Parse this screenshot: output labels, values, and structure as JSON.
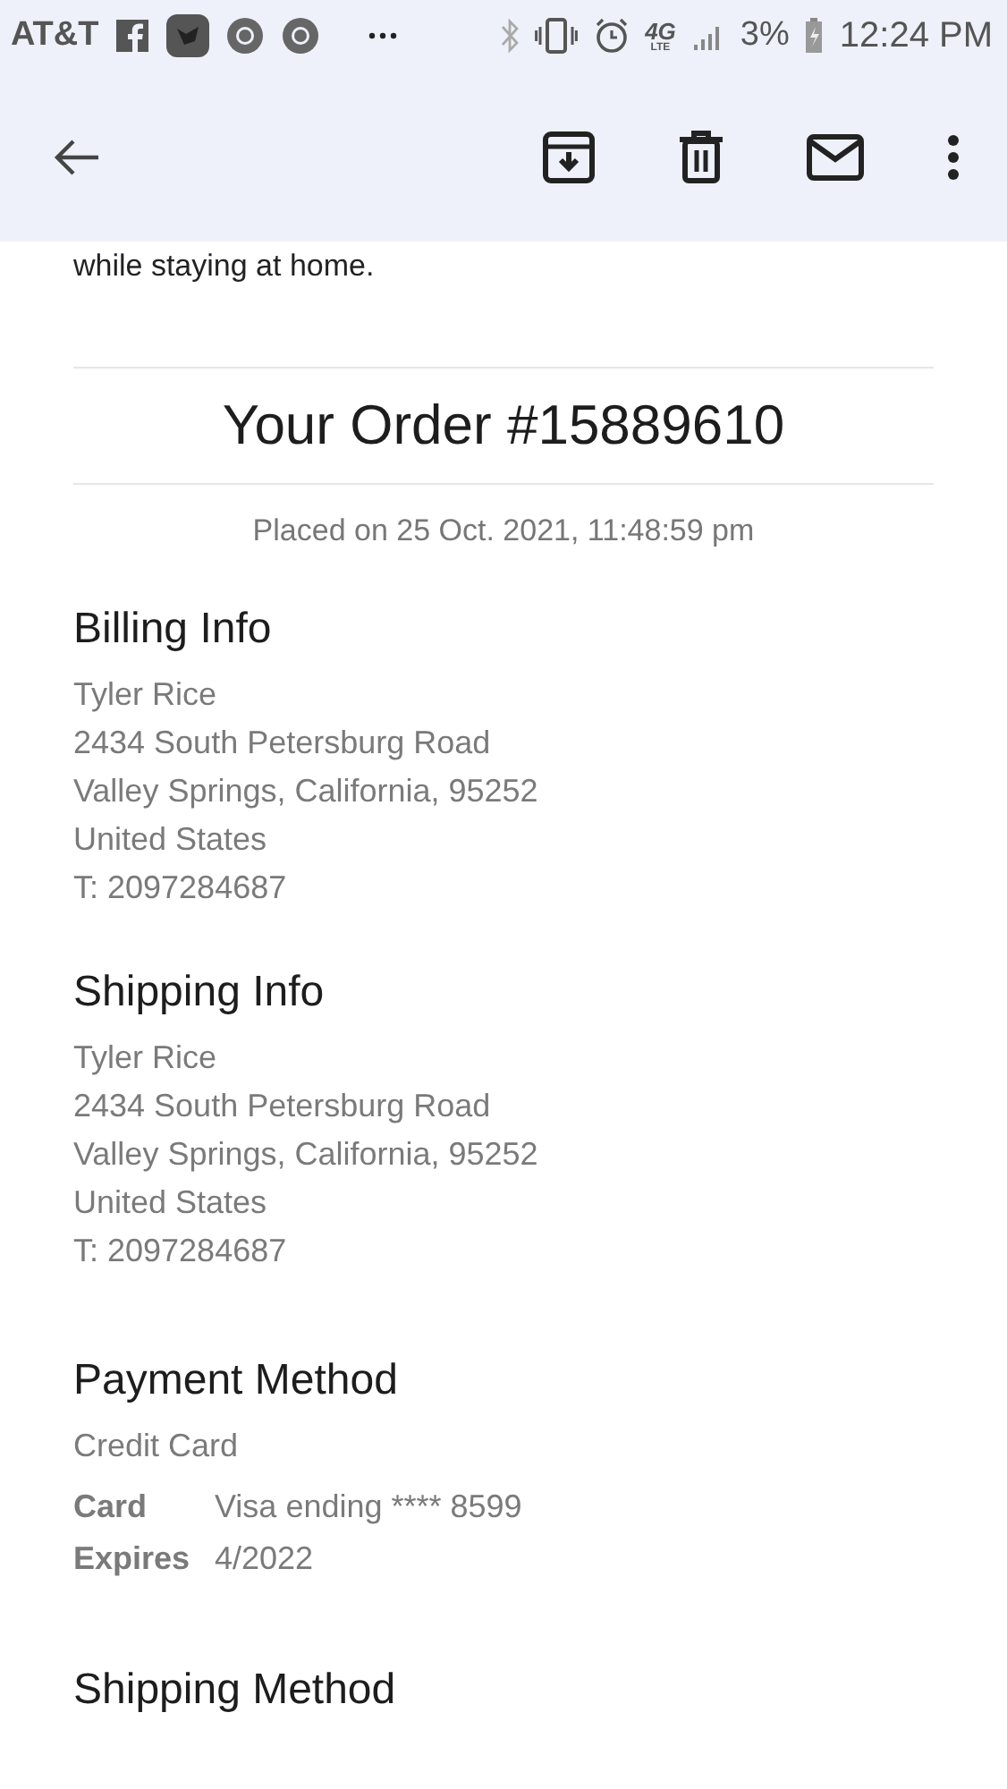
{
  "status_bar": {
    "carrier": "AT&T",
    "network": "4G",
    "network_sub": "LTE",
    "battery": "3%",
    "time": "12:24 PM"
  },
  "intro_text": "while staying at home.",
  "order_title": "Your Order #15889610",
  "placed": "Placed on 25 Oct. 2021, 11:48:59 pm",
  "sections": [
    {
      "kind": "lines",
      "title": "Billing Info",
      "lines": [
        "Tyler Rice",
        "2434 South Petersburg Road",
        "Valley Springs, California, 95252",
        "United States",
        "T: 2097284687"
      ]
    },
    {
      "kind": "lines",
      "title": "Shipping Info",
      "lines": [
        "Tyler Rice",
        "2434 South Petersburg Road",
        "Valley Springs, California, 95252",
        "United States",
        "T: 2097284687"
      ]
    },
    {
      "kind": "payment",
      "title": "Payment Method",
      "method": "Credit Card",
      "fields": [
        {
          "label": "Card",
          "value": "Visa ending **** 8599"
        },
        {
          "label": "Expires",
          "value": "4/2022"
        }
      ]
    },
    {
      "kind": "heading",
      "title": "Shipping Method"
    }
  ]
}
